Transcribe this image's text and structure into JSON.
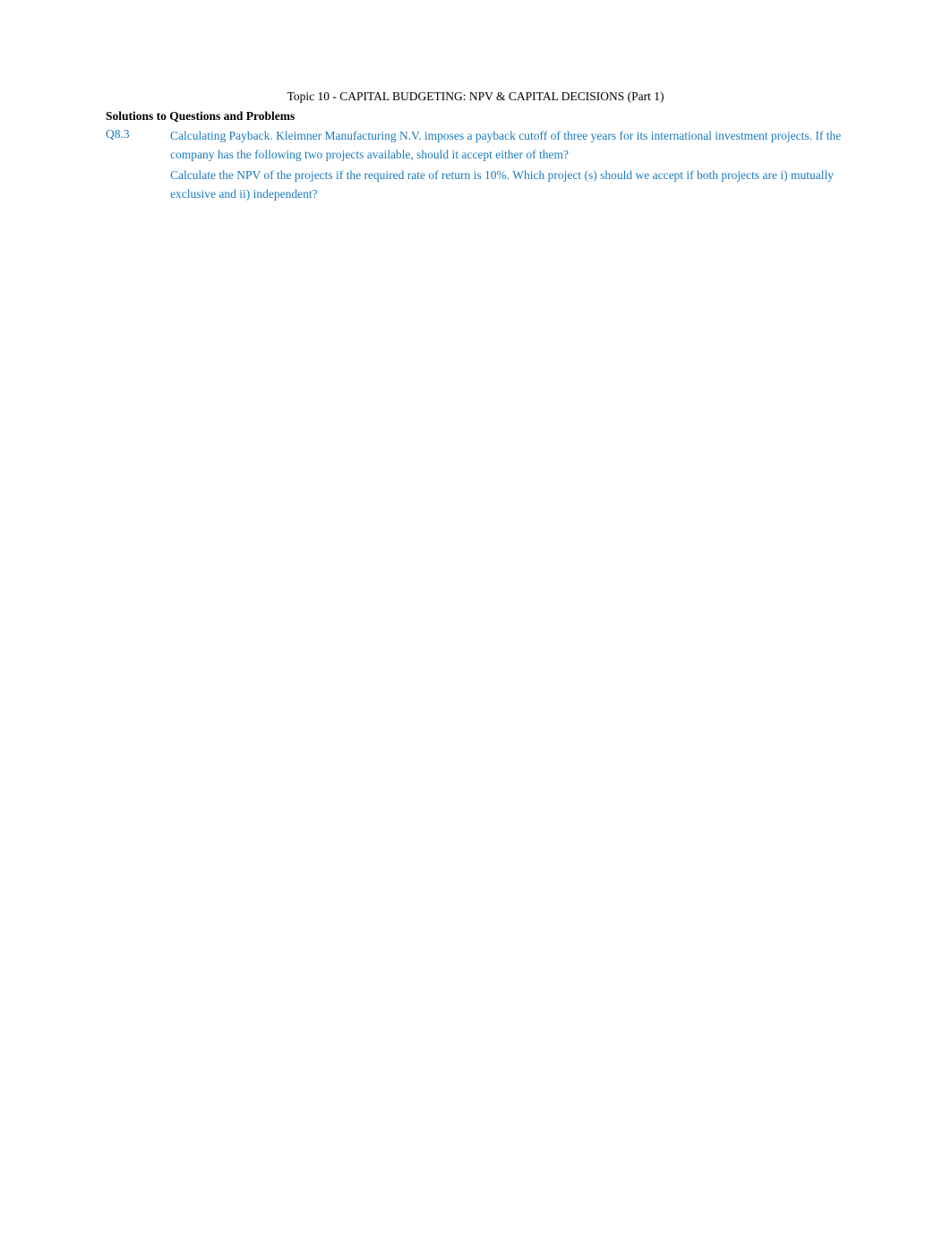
{
  "page": {
    "title": "Topic 10 -  CAPITAL BUDGETING: NPV & CAPITAL DECISIONS (Part 1)",
    "section_header": "Solutions to Questions and Problems",
    "questions": [
      {
        "id": "Q8.3",
        "paragraphs": [
          "Calculating Payback.    Kleimner Manufacturing N.V. imposes a payback cutoff of three years for its international investment projects. If the company has the following two projects available, should it accept either of them?",
          "Calculate the NPV of the projects if the required rate of return is 10%. Which project (s) should we accept if both projects are i) mutually exclusive and ii) independent?"
        ]
      }
    ]
  }
}
